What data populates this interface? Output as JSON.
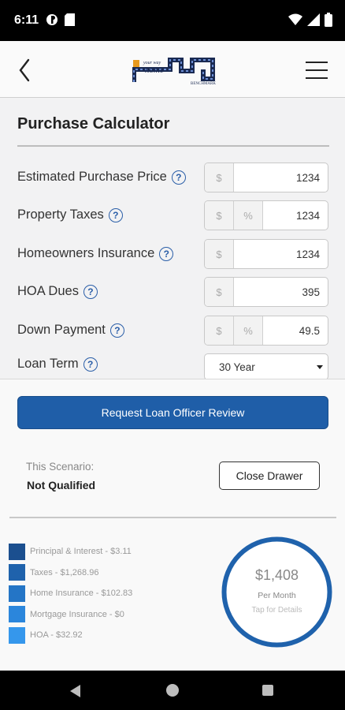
{
  "status_bar": {
    "time": "6:11"
  },
  "calculator": {
    "title": "Purchase Calculator",
    "fields": [
      {
        "label": "Estimated Purchase Price",
        "prefix": "$",
        "value": "1234"
      },
      {
        "label": "Property Taxes",
        "prefix": "$",
        "unit": "%",
        "value": "1234"
      },
      {
        "label": "Homeowners Insurance",
        "prefix": "$",
        "value": "1234"
      },
      {
        "label": "HOA Dues",
        "prefix": "$",
        "value": "395"
      },
      {
        "label": "Down Payment",
        "prefix": "$",
        "unit": "%",
        "value": "49.5"
      }
    ],
    "loan_term": {
      "label": "Loan Term",
      "selected": "30 Year"
    }
  },
  "drawer": {
    "request_button": "Request Loan Officer Review",
    "scenario_label": "This Scenario:",
    "scenario_value": "Not Qualified",
    "close_button": "Close Drawer",
    "legend": [
      {
        "text": "Principal & Interest - $3.11",
        "color": "#1b4f8f"
      },
      {
        "text": "Taxes - $1,268.96",
        "color": "#1f62ac"
      },
      {
        "text": "Home Insurance - $102.83",
        "color": "#2475c6"
      },
      {
        "text": "Mortgage Insurance - $0",
        "color": "#2b86dc"
      },
      {
        "text": "HOA - $32.92",
        "color": "#3597ec"
      }
    ],
    "summary": {
      "amount": "$1,408",
      "period": "Per Month",
      "hint": "Tap for Details",
      "ring_color": "#1f62ac"
    }
  },
  "icons": {
    "back": "chevron-left-icon",
    "menu": "hamburger-menu-icon",
    "help": "question-circle-icon",
    "dropdown": "caret-down-icon"
  }
}
